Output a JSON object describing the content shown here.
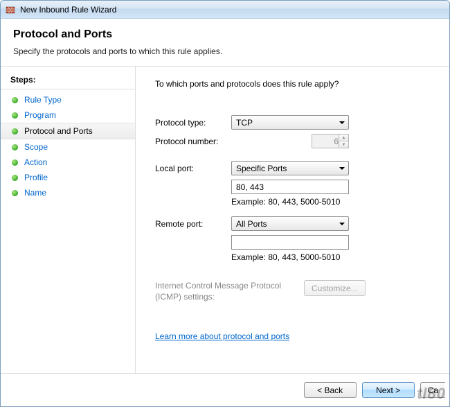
{
  "window": {
    "title": "New Inbound Rule Wizard"
  },
  "header": {
    "title": "Protocol and Ports",
    "subtitle": "Specify the protocols and ports to which this rule applies."
  },
  "steps": {
    "header": "Steps:",
    "items": [
      {
        "label": "Rule Type",
        "active": false
      },
      {
        "label": "Program",
        "active": false
      },
      {
        "label": "Protocol and Ports",
        "active": true
      },
      {
        "label": "Scope",
        "active": false
      },
      {
        "label": "Action",
        "active": false
      },
      {
        "label": "Profile",
        "active": false
      },
      {
        "label": "Name",
        "active": false
      }
    ]
  },
  "main": {
    "question": "To which ports and protocols does this rule apply?",
    "protocol_type_label": "Protocol type:",
    "protocol_type_value": "TCP",
    "protocol_number_label": "Protocol number:",
    "protocol_number_value": "6",
    "local_port_label": "Local port:",
    "local_port_select": "Specific Ports",
    "local_port_value": "80, 443",
    "remote_port_label": "Remote port:",
    "remote_port_select": "All Ports",
    "remote_port_value": "",
    "example_text": "Example: 80, 443, 5000-5010",
    "icmp_label": "Internet Control Message Protocol (ICMP) settings:",
    "customize_label": "Customize...",
    "learn_link": "Learn more about protocol and ports"
  },
  "footer": {
    "back": "< Back",
    "next": "Next >",
    "cancel": "Ca"
  },
  "watermark": "tl80"
}
